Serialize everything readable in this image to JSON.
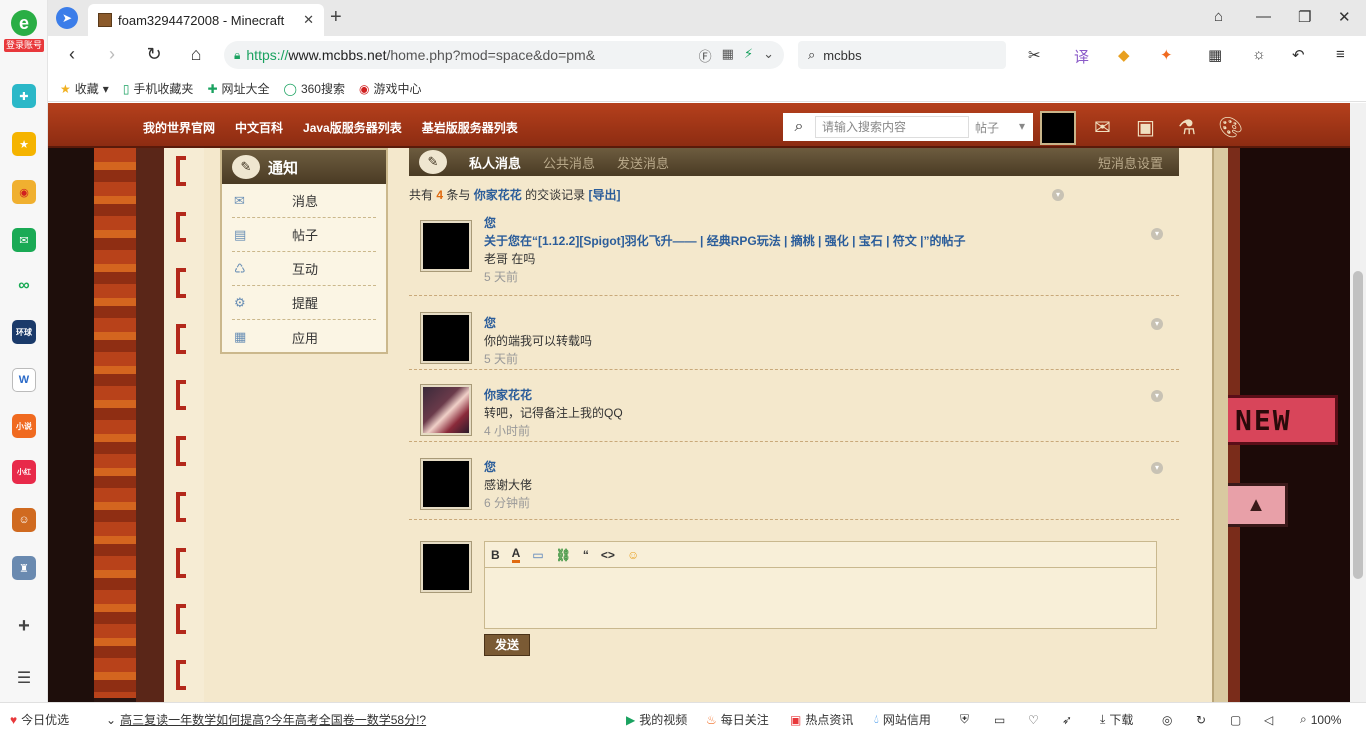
{
  "browser": {
    "left_login_label": "登录账号",
    "tab_title": "foam3294472008 - Minecraft",
    "url_scheme": "https://",
    "url_host": "www.mcbbs.net",
    "url_path": "/home.php?mod=space&do=pm&",
    "search_query": "mcbbs",
    "bookmarks": [
      "收藏",
      "手机收藏夹",
      "网址大全",
      "360搜索",
      "游戏中心"
    ]
  },
  "site": {
    "nav_links": [
      "我的世界官网",
      "中文百科",
      "Java版服务器列表",
      "基岩版服务器列表"
    ],
    "search_placeholder": "请输入搜索内容",
    "search_scope": "帖子"
  },
  "sidebar": {
    "title": "通知",
    "items": [
      {
        "label": "消息",
        "icon": "envelope-icon"
      },
      {
        "label": "帖子",
        "icon": "document-icon"
      },
      {
        "label": "互动",
        "icon": "recycle-icon"
      },
      {
        "label": "提醒",
        "icon": "gear-icon"
      },
      {
        "label": "应用",
        "icon": "grid-icon"
      }
    ]
  },
  "pm": {
    "tabs": {
      "active": "私人消息",
      "public": "公共消息",
      "send": "发送消息",
      "settings": "短消息设置"
    },
    "summary": {
      "prefix": "共有",
      "count": "4",
      "mid": "条与",
      "user": "你家花花",
      "suffix": "的交谈记录",
      "export": "[导出]"
    },
    "messages": [
      {
        "author": "您",
        "subject": "关于您在“[1.12.2][Spigot]羽化飞升—— | 经典RPG玩法 | 摘桃 | 强化 | 宝石 | 符文 |”的帖子",
        "text": "老哥 在吗",
        "time": "5 天前"
      },
      {
        "author": "您",
        "subject": "",
        "text": "你的端我可以转载吗",
        "time": "5 天前"
      },
      {
        "author": "你家花花",
        "subject": "",
        "text": "转吧，记得备注上我的QQ",
        "time": "4 小时前"
      },
      {
        "author": "您",
        "subject": "",
        "text": "感谢大佬",
        "time": "6 分钟前"
      }
    ],
    "send_label": "发送"
  },
  "statusbar": {
    "today": "今日优选",
    "headline": "高三复读一年数学如何提高?今年高考全国卷一数学58分!?",
    "items": [
      "我的视频",
      "每日关注",
      "热点资讯",
      "网站信用"
    ],
    "download": "下载",
    "zoom": "100%"
  },
  "colors": {
    "accent_link": "#2b5d9a",
    "nav_red": "#a63718",
    "count_orange": "#e06a10"
  }
}
